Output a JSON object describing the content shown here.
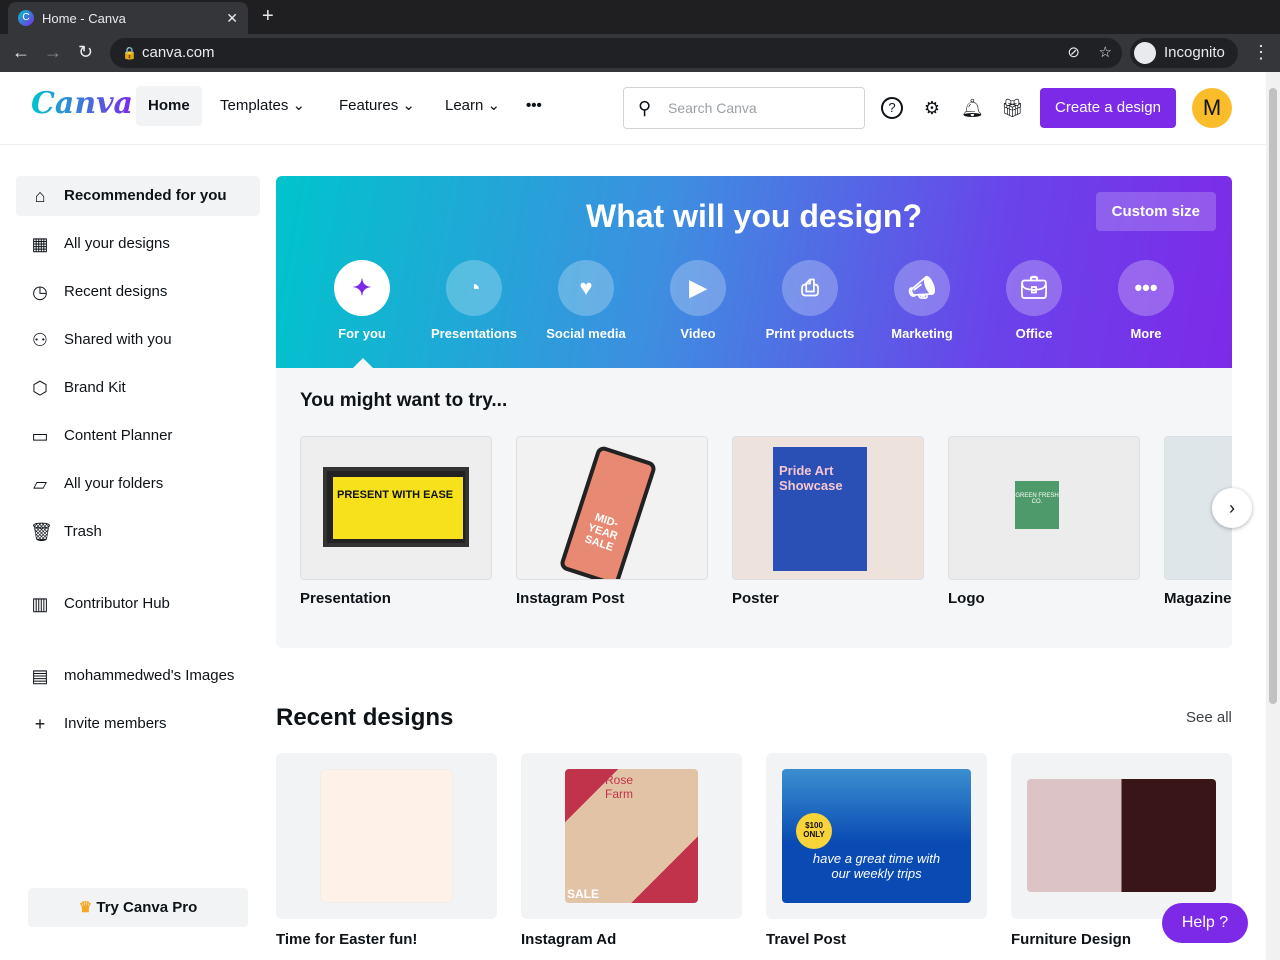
{
  "browser": {
    "tab_title": "Home - Canva",
    "url": "canva.com",
    "profile": "Incognito"
  },
  "header": {
    "logo": "Canva",
    "nav": [
      "Home",
      "Templates",
      "Features",
      "Learn"
    ],
    "more": "•••",
    "search_placeholder": "Search Canva",
    "create": "Create a design",
    "avatar": "M"
  },
  "sidebar": {
    "items": [
      "Recommended for you",
      "All your designs",
      "Recent designs",
      "Shared with you",
      "Brand Kit",
      "Content Planner",
      "All your folders",
      "Trash",
      "Contributor Hub",
      "mohammedwed's Images",
      "Invite members"
    ],
    "pro": "Try Canva Pro"
  },
  "hero": {
    "title": "What will you design?",
    "custom": "Custom size",
    "categories": [
      "For you",
      "Presentations",
      "Social media",
      "Video",
      "Print products",
      "Marketing",
      "Office",
      "More"
    ]
  },
  "try": {
    "title": "You might want to try...",
    "items": [
      "Presentation",
      "Instagram Post",
      "Poster",
      "Logo",
      "Magazine"
    ],
    "thumb_text": {
      "presentation": "PRESENT WITH EASE",
      "instagram": "MID-YEAR SALE",
      "poster": "Pride Art Showcase",
      "logo": "GREEN FRESH CO."
    }
  },
  "recent": {
    "title": "Recent designs",
    "see_all": "See all",
    "items": [
      "Time for Easter fun!",
      "Instagram Ad",
      "Travel Post",
      "Furniture Design"
    ],
    "thumb_text": {
      "rose": "Rose Farm",
      "sale": "SALE",
      "travel": "have a great time with our weekly trips",
      "price": "$100 ONLY"
    }
  },
  "help": "Help ?"
}
